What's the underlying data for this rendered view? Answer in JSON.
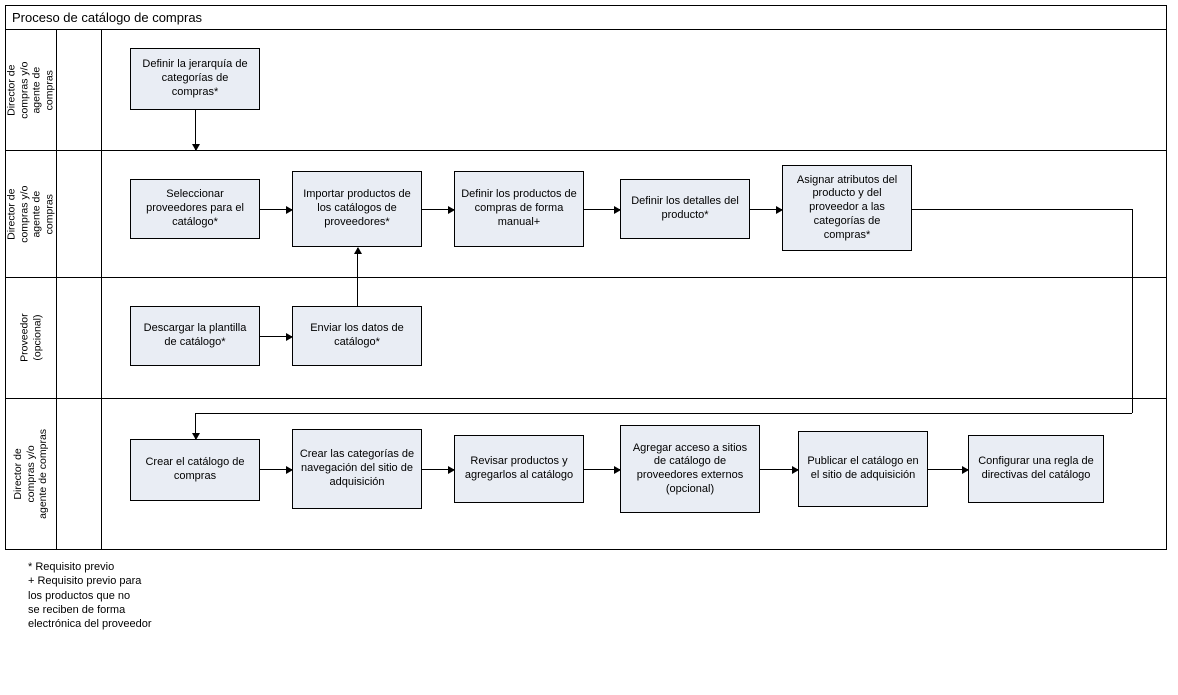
{
  "title": "Proceso de catálogo de compras",
  "lanes": [
    {
      "label": "Director de\ncompras y/o\nagente de\ncompras"
    },
    {
      "label": "Director de\ncompras y/o\nagente de\ncompras"
    },
    {
      "label": "Proveedor\n(opcional)"
    },
    {
      "label": "Director de\ncompras y/o\nagente de compras"
    }
  ],
  "nodes": {
    "lane1": {
      "n1": "Definir la jerarquía de categorías de compras*"
    },
    "lane2": {
      "n1": "Seleccionar proveedores para el catálogo*",
      "n2": "Importar productos de los catálogos de proveedores*",
      "n3": "Definir los productos de compras de forma manual+",
      "n4": "Definir los detalles del producto*",
      "n5": "Asignar atributos del producto y del proveedor a las categorías de compras*"
    },
    "lane3": {
      "n1": "Descargar la plantilla de catálogo*",
      "n2": "Enviar los datos de catálogo*"
    },
    "lane4": {
      "n1": "Crear el catálogo de compras",
      "n2": "Crear las categorías de navegación del sitio de adquisición",
      "n3": "Revisar productos y agregarlos al catálogo",
      "n4": "Agregar acceso a sitios de catálogo de proveedores externos (opcional)",
      "n5": "Publicar el catálogo en el sitio de adquisición",
      "n6": "Configurar una regla de directivas del catálogo"
    }
  },
  "footnotes": [
    "* Requisito previo",
    "+ Requisito previo para",
    "  los productos que no",
    "  se reciben de forma",
    "  electrónica del proveedor"
  ]
}
